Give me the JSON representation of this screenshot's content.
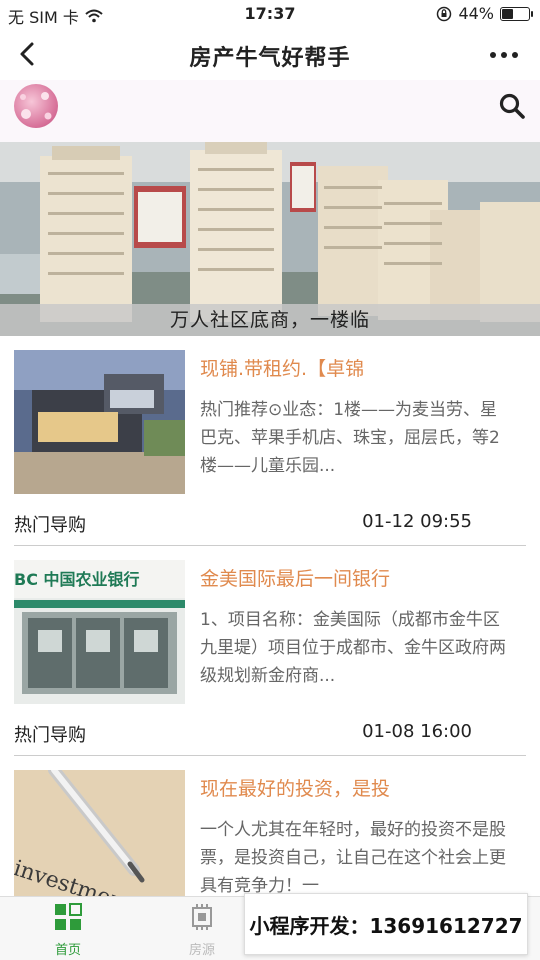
{
  "status_bar": {
    "carrier": "无 SIM 卡",
    "time": "17:37",
    "battery": "44%",
    "battery_level": 0.44
  },
  "nav": {
    "title": "房产牛气好帮手"
  },
  "banner": {
    "caption": "万人社区底商，一楼临"
  },
  "list": [
    {
      "title": "现铺.带租约.【卓锦",
      "desc": "热门推荐⊙业态：1楼——为麦当劳、星巴克、苹果手机店、珠宝，屈层氏，等2楼——儿童乐园...",
      "tag": "热门导购",
      "time": "01-12 09:55"
    },
    {
      "title": "金美国际最后一间银行",
      "desc": "1、项目名称：金美国际（成都市金牛区九里堤）项目位于成都市、金牛区政府两级规划新金府商...",
      "tag": "热门导购",
      "time": "01-08 16:00",
      "image_text": "BC 中国农业银行"
    },
    {
      "title": "现在最好的投资，是投",
      "desc": "一个人尤其在年轻时，最好的投资不是股票，是投资自己，让自己在这个社会上更具有竞争力！一",
      "image_text": "investment"
    }
  ],
  "tabs": [
    {
      "label": "首页",
      "icon": "grid-icon",
      "active": true
    },
    {
      "label": "房源",
      "icon": "chip-icon",
      "active": false
    }
  ],
  "promo": {
    "text": "小程序开发：13691612727"
  },
  "colors": {
    "accent_title": "#e08a4e",
    "tab_active": "#2e9b3a"
  }
}
